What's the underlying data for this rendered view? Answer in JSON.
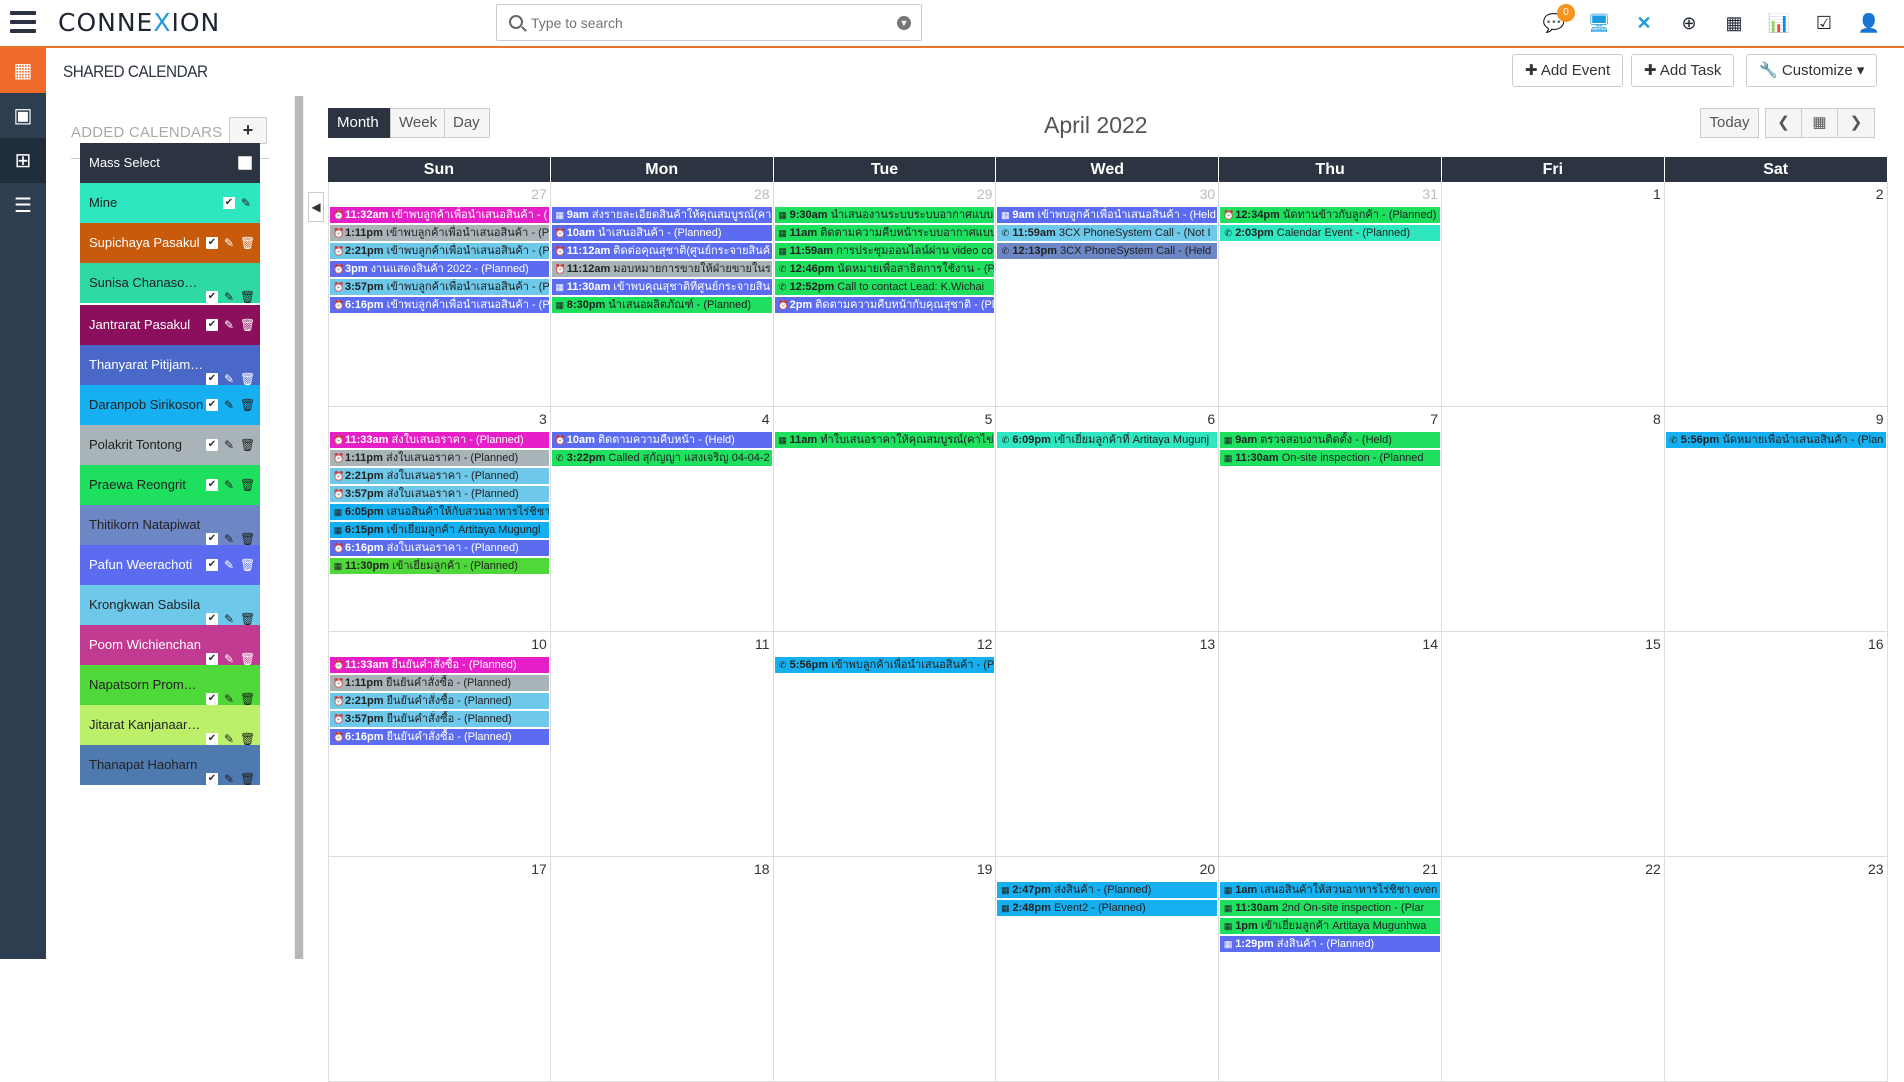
{
  "app": {
    "logo_text": "CONNE",
    "logo_x": "X",
    "logo_tail": "ION"
  },
  "search": {
    "placeholder": "Type to search"
  },
  "topbar": {
    "notification_count": "0"
  },
  "page": {
    "title": "SHARED CALENDAR"
  },
  "header_buttons": {
    "add_event": "Add Event",
    "add_task": "Add Task",
    "customize": "Customize"
  },
  "calendars": {
    "title": "ADDED CALENDARS",
    "add_label": "+",
    "items": [
      {
        "name": "Mass Select",
        "color": "#2b3440",
        "light": true
      },
      {
        "name": "Mine",
        "color": "#2ee6c0",
        "light": false
      },
      {
        "name": "Supichaya Pasakul",
        "color": "#c85a0c",
        "light": true
      },
      {
        "name": "Sunisa Chanasomb...",
        "color": "#2fd9a3",
        "light": false
      },
      {
        "name": "Jantrarat Pasakul",
        "color": "#8b0f5c",
        "light": true
      },
      {
        "name": "Thanyarat Pitijamr...",
        "color": "#4a68c8",
        "light": true
      },
      {
        "name": "Daranpob Sirikoson",
        "color": "#16b0f0",
        "light": false
      },
      {
        "name": "Polakrit Tontong",
        "color": "#a8b4b8",
        "light": false
      },
      {
        "name": "Praewa Reongrit",
        "color": "#1fe05e",
        "light": false
      },
      {
        "name": "Thitikorn Natapiwat",
        "color": "#6d86c4",
        "light": false
      },
      {
        "name": "Pafun Weerachoti",
        "color": "#5b6cf0",
        "light": true
      },
      {
        "name": "Krongkwan Sabsila",
        "color": "#6dc8ea",
        "light": false
      },
      {
        "name": "Poom Wichienchan",
        "color": "#c23b92",
        "light": true
      },
      {
        "name": "Napatsorn Promm...",
        "color": "#4fd83a",
        "light": false
      },
      {
        "name": "Jitarat Kanjanaarkom",
        "color": "#bdf06a",
        "light": false
      },
      {
        "name": "Thanapat Haoharn",
        "color": "#4f7ab0",
        "light": false
      }
    ]
  },
  "calendar": {
    "views": {
      "month": "Month",
      "week": "Week",
      "day": "Day"
    },
    "title": "April 2022",
    "today": "Today",
    "dow": [
      "Sun",
      "Mon",
      "Tue",
      "Wed",
      "Thu",
      "Fri",
      "Sat"
    ],
    "weeks": [
      [
        {
          "num": "27",
          "other": true,
          "events": [
            {
              "icon": "task",
              "time": "11:32am",
              "text": "เข้าพบลูกค้าเพื่อนำเสนอสินค้า - (",
              "color": "#e61ec8",
              "light": true
            },
            {
              "icon": "task",
              "time": "1:11pm",
              "text": "เข้าพบลูกค้าเพื่อนำเสนอสินค้า - (P",
              "color": "#a8b4b8",
              "light": false
            },
            {
              "icon": "task",
              "time": "2:21pm",
              "text": "เข้าพบลูกค้าเพื่อนำเสนอสินค้า - (P",
              "color": "#6dc8ea",
              "light": false
            },
            {
              "icon": "task",
              "time": "3pm",
              "text": "งานแสดงสินค้า 2022 - (Planned)",
              "color": "#5b6cf0",
              "light": true
            },
            {
              "icon": "task",
              "time": "3:57pm",
              "text": "เข้าพบลูกค้าเพื่อนำเสนอสินค้า - (P",
              "color": "#6dc8ea",
              "light": false
            },
            {
              "icon": "task",
              "time": "6:16pm",
              "text": "เข้าพบลูกค้าเพื่อนำเสนอสินค้า - (P",
              "color": "#5b6cf0",
              "light": true
            }
          ]
        },
        {
          "num": "28",
          "other": true,
          "events": [
            {
              "icon": "cal",
              "time": "9am",
              "text": "ส่งรายละเอียดสินค้าให้คุณสมบูรณ์(คา",
              "color": "#5b6cf0",
              "light": true
            },
            {
              "icon": "task",
              "time": "10am",
              "text": "นำเสนอสินค้า - (Planned)",
              "color": "#5b6cf0",
              "light": true
            },
            {
              "icon": "task",
              "time": "11:12am",
              "text": "ติดต่อคุณสุชาติ(ศูนย์กระจายสินค้",
              "color": "#5b6cf0",
              "light": true
            },
            {
              "icon": "task",
              "time": "11:12am",
              "text": "มอบหมายการขายให้ฝ่ายขายในร",
              "color": "#a8b4b8",
              "light": false
            },
            {
              "icon": "cal",
              "time": "11:30am",
              "text": "เข้าพบคุณสุชาติที่ศูนย์กระจายสิน",
              "color": "#5b6cf0",
              "light": true
            },
            {
              "icon": "cal",
              "time": "8:30pm",
              "text": "นำเสนอผลิตภัณฑ์ - (Planned)",
              "color": "#1fe05e",
              "light": false
            }
          ]
        },
        {
          "num": "29",
          "other": true,
          "events": [
            {
              "icon": "cal",
              "time": "9:30am",
              "text": "นำเสนองานระบบระบบอากาศแบบ",
              "color": "#1fe05e",
              "light": false
            },
            {
              "icon": "cal",
              "time": "11am",
              "text": "ติดตามความคืบหน้าระบบอากาศแบบไ",
              "color": "#1fe05e",
              "light": false
            },
            {
              "icon": "cal",
              "time": "11:59am",
              "text": "การประชุมออนไลน์ผ่าน video co",
              "color": "#1fe05e",
              "light": false
            },
            {
              "icon": "call",
              "time": "12:46pm",
              "text": "นัดหมายเพื่อสาธิตการใช้งาน - (Pl",
              "color": "#1fe05e",
              "light": false
            },
            {
              "icon": "call",
              "time": "12:52pm",
              "text": "Call to contact Lead: K.Wichai",
              "color": "#1fe05e",
              "light": false
            },
            {
              "icon": "task",
              "time": "2pm",
              "text": "ติดตามความคืบหน้ากับคุณสุชาติ - (Plan",
              "color": "#5b6cf0",
              "light": true
            }
          ]
        },
        {
          "num": "30",
          "other": true,
          "events": [
            {
              "icon": "cal",
              "time": "9am",
              "text": "เข้าพบลูกค้าเพื่อนำเสนอสินค้า - (Held",
              "color": "#5b6cf0",
              "light": true
            },
            {
              "icon": "call",
              "time": "11:59am",
              "text": "3CX PhoneSystem Call - (Not I",
              "color": "#6dc8ea",
              "light": false
            },
            {
              "icon": "call",
              "time": "12:13pm",
              "text": "3CX PhoneSystem Call - (Held",
              "color": "#6d86c4",
              "light": false
            }
          ]
        },
        {
          "num": "31",
          "other": true,
          "events": [
            {
              "icon": "task",
              "time": "12:34pm",
              "text": "นัดทานข้าวกับลูกค้า - (Planned)",
              "color": "#1fe05e",
              "light": false
            },
            {
              "icon": "call",
              "time": "2:03pm",
              "text": "Calendar Event - (Planned)",
              "color": "#2ee6c0",
              "light": false
            }
          ]
        },
        {
          "num": "1",
          "other": false,
          "events": []
        },
        {
          "num": "2",
          "other": false,
          "events": []
        }
      ],
      [
        {
          "num": "3",
          "other": false,
          "events": [
            {
              "icon": "task",
              "time": "11:33am",
              "text": "ส่งใบเสนอราคา - (Planned)",
              "color": "#e61ec8",
              "light": true
            },
            {
              "icon": "task",
              "time": "1:11pm",
              "text": "ส่งใบเสนอราคา - (Planned)",
              "color": "#a8b4b8",
              "light": false
            },
            {
              "icon": "task",
              "time": "2:21pm",
              "text": "ส่งใบเสนอราคา - (Planned)",
              "color": "#6dc8ea",
              "light": false
            },
            {
              "icon": "task",
              "time": "3:57pm",
              "text": "ส่งใบเสนอราคา - (Planned)",
              "color": "#6dc8ea",
              "light": false
            },
            {
              "icon": "cal",
              "time": "6:05pm",
              "text": "เสนอสินค้าให้กับสวนอาหารไร่ชิชา",
              "color": "#16b0f0",
              "light": false
            },
            {
              "icon": "cal",
              "time": "6:15pm",
              "text": "เข้าเยี่ยมลูกค้า Artitaya Mugungl",
              "color": "#16b0f0",
              "light": false
            },
            {
              "icon": "task",
              "time": "6:16pm",
              "text": "ส่งใบเสนอราคา - (Planned)",
              "color": "#5b6cf0",
              "light": true
            },
            {
              "icon": "cal",
              "time": "11:30pm",
              "text": "เข้าเยี่ยมลูกค้า - (Planned)",
              "color": "#4fd83a",
              "light": false
            }
          ]
        },
        {
          "num": "4",
          "other": false,
          "events": [
            {
              "icon": "task",
              "time": "10am",
              "text": "ติดตามความคืบหน้า - (Held)",
              "color": "#5b6cf0",
              "light": true
            },
            {
              "icon": "call",
              "time": "3:22pm",
              "text": "Called สุกัญญา แสงเจริญ 04-04-2",
              "color": "#1fe05e",
              "light": false
            }
          ]
        },
        {
          "num": "5",
          "other": false,
          "events": [
            {
              "icon": "cal",
              "time": "11am",
              "text": "ทำใบเสนอราคาให้คุณสมบูรณ์(คาไข่",
              "color": "#1fe05e",
              "light": false
            }
          ]
        },
        {
          "num": "6",
          "other": false,
          "events": [
            {
              "icon": "call",
              "time": "6:09pm",
              "text": "เข้าเยี่ยมลูกค้าที่ Artitaya Mugunj",
              "color": "#2ee6c0",
              "light": false
            }
          ]
        },
        {
          "num": "7",
          "other": false,
          "events": [
            {
              "icon": "cal",
              "time": "9am",
              "text": "ตรวจสอบงานติดตั้ง - (Held)",
              "color": "#1fe05e",
              "light": false
            },
            {
              "icon": "cal",
              "time": "11:30am",
              "text": "On-site inspection - (Planned",
              "color": "#1fe05e",
              "light": false
            }
          ]
        },
        {
          "num": "8",
          "other": false,
          "events": []
        },
        {
          "num": "9",
          "other": false,
          "events": [
            {
              "icon": "call",
              "time": "5:56pm",
              "text": "นัดหมายเพื่อนำเสนอสินค้า - (Plan",
              "color": "#16b0f0",
              "light": false
            }
          ]
        }
      ],
      [
        {
          "num": "10",
          "other": false,
          "events": [
            {
              "icon": "task",
              "time": "11:33am",
              "text": "ยืนยันคำสั่งซื้อ - (Planned)",
              "color": "#e61ec8",
              "light": true
            },
            {
              "icon": "task",
              "time": "1:11pm",
              "text": "ยืนยันคำสั่งซื้อ - (Planned)",
              "color": "#a8b4b8",
              "light": false
            },
            {
              "icon": "task",
              "time": "2:21pm",
              "text": "ยืนยันคำสั่งซื้อ - (Planned)",
              "color": "#6dc8ea",
              "light": false
            },
            {
              "icon": "task",
              "time": "3:57pm",
              "text": "ยืนยันคำสั่งซื้อ - (Planned)",
              "color": "#6dc8ea",
              "light": false
            },
            {
              "icon": "task",
              "time": "6:16pm",
              "text": "ยืนยันคำสั่งซื้อ - (Planned)",
              "color": "#5b6cf0",
              "light": true
            }
          ]
        },
        {
          "num": "11",
          "other": false,
          "events": []
        },
        {
          "num": "12",
          "other": false,
          "events": [
            {
              "icon": "call",
              "time": "5:56pm",
              "text": "เข้าพบลูกค้าเพื่อนำเสนอสินค้า - (P",
              "color": "#16b0f0",
              "light": false
            }
          ]
        },
        {
          "num": "13",
          "other": false,
          "events": []
        },
        {
          "num": "14",
          "other": false,
          "events": []
        },
        {
          "num": "15",
          "other": false,
          "events": []
        },
        {
          "num": "16",
          "other": false,
          "events": []
        }
      ],
      [
        {
          "num": "17",
          "other": false,
          "events": []
        },
        {
          "num": "18",
          "other": false,
          "events": []
        },
        {
          "num": "19",
          "other": false,
          "events": []
        },
        {
          "num": "20",
          "other": false,
          "events": [
            {
              "icon": "cal",
              "time": "2:47pm",
              "text": "ส่งสินค้า - (Planned)",
              "color": "#16b0f0",
              "light": false
            },
            {
              "icon": "cal",
              "time": "2:48pm",
              "text": "Event2 - (Planned)",
              "color": "#16b0f0",
              "light": false
            }
          ]
        },
        {
          "num": "21",
          "other": false,
          "events": [
            {
              "icon": "cal",
              "time": "1am",
              "text": "เสนอสินค้าให้สวนอาหารไร่ชิชา even",
              "color": "#16b0f0",
              "light": false
            },
            {
              "icon": "cal",
              "time": "11:30am",
              "text": "2nd On-site inspection - (Plar",
              "color": "#1fe05e",
              "light": false
            },
            {
              "icon": "cal",
              "time": "1pm",
              "text": "เข้าเยี่ยมลูกค้า Artitaya Mugunhwa",
              "color": "#1fe05e",
              "light": false
            },
            {
              "icon": "cal",
              "time": "1:29pm",
              "text": "ส่งสินค้า - (Planned)",
              "color": "#5b6cf0",
              "light": true
            }
          ]
        },
        {
          "num": "22",
          "other": false,
          "events": []
        },
        {
          "num": "23",
          "other": false,
          "events": []
        }
      ]
    ]
  }
}
